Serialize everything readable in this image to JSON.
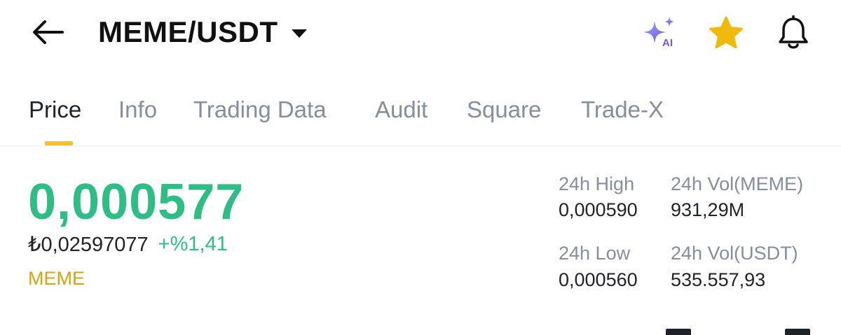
{
  "header": {
    "pair": "MEME/USDT",
    "ai_badge_text": "AI",
    "icons": [
      "back-arrow-icon",
      "dropdown-caret-icon",
      "ai-sparkle-icon",
      "star-icon",
      "bell-icon"
    ],
    "favorite_color": "#f0b90b",
    "ai_color": "#7b8cf5"
  },
  "tabs": [
    {
      "label": "Price",
      "active": true
    },
    {
      "label": "Info",
      "active": false
    },
    {
      "label": "Trading Data",
      "active": false
    },
    {
      "label": "Audit",
      "active": false
    },
    {
      "label": "Square",
      "active": false
    },
    {
      "label": "Trade-X",
      "active": false
    }
  ],
  "market": {
    "last_price": "0,000577",
    "fiat_price": "₺0,02597077",
    "change": "+%1,41",
    "base_asset": "MEME"
  },
  "stats": {
    "high_label": "24h High",
    "high_value": "0,000590",
    "low_label": "24h Low",
    "low_value": "0,000560",
    "vol_base_label": "24h Vol(MEME)",
    "vol_base_value": "931,29M",
    "vol_quote_label": "24h Vol(USDT)",
    "vol_quote_value": "535.557,93"
  },
  "colors": {
    "up": "#2ebd85",
    "accent": "#f0c232",
    "muted": "#848e9c",
    "text": "#1e2329"
  }
}
